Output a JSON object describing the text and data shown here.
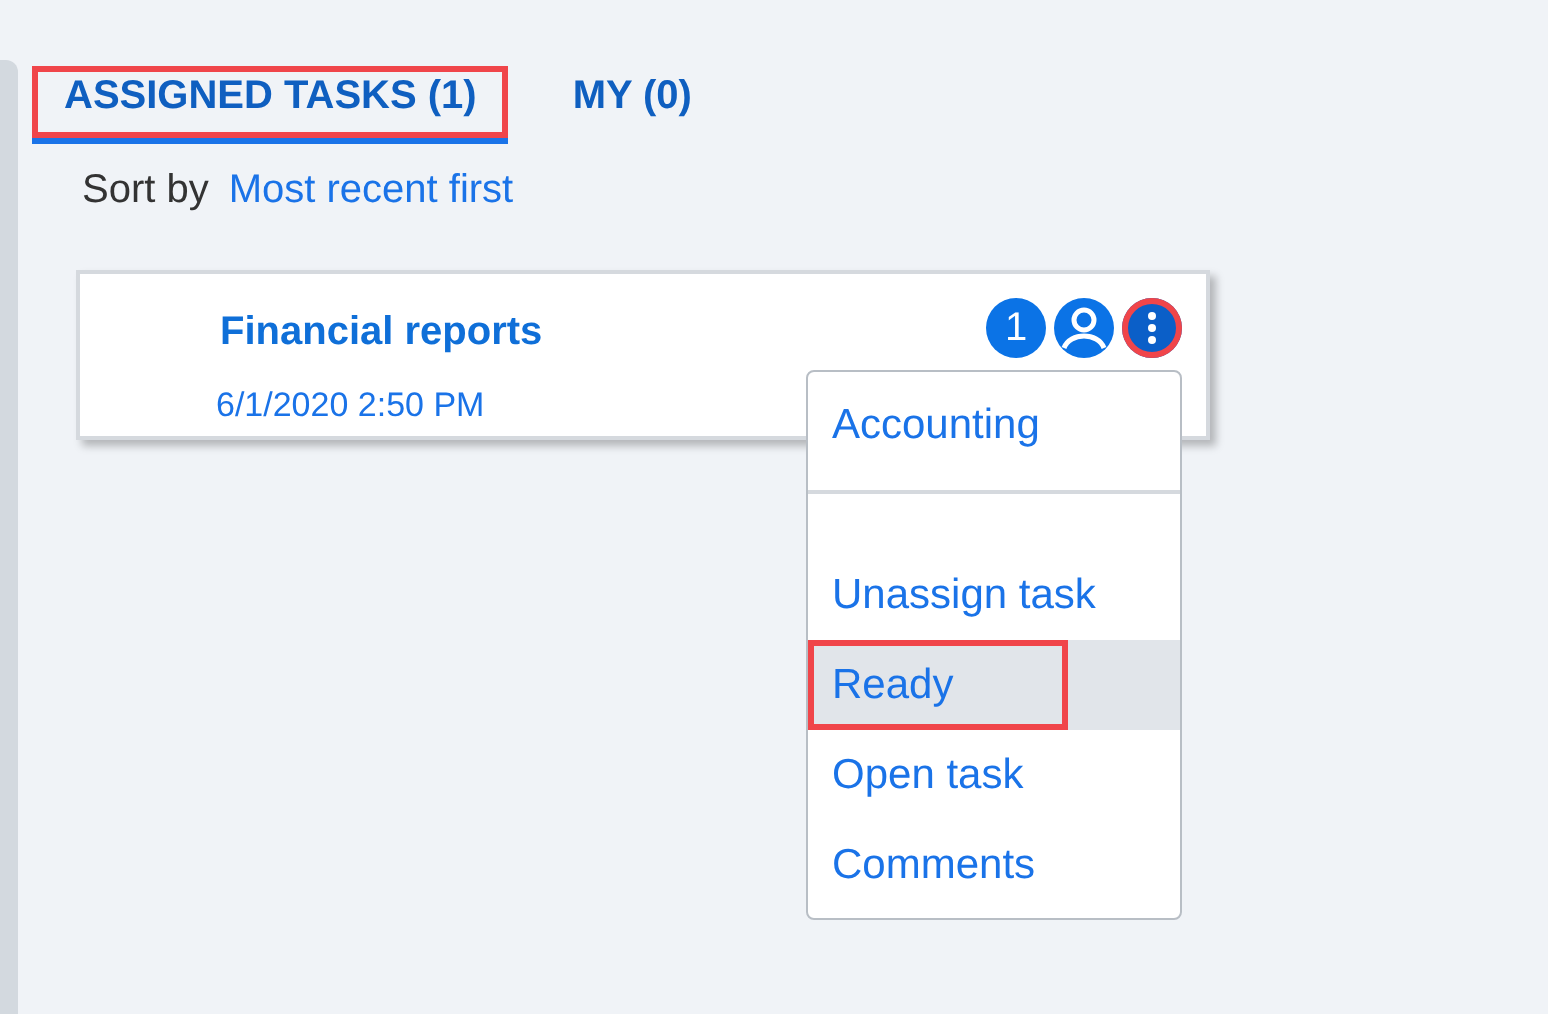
{
  "tabs": [
    {
      "label": "ASSIGNED TASKS (1)",
      "selected": true,
      "highlighted": true
    },
    {
      "label": "MY (0)",
      "selected": false,
      "highlighted": false
    }
  ],
  "sort": {
    "label": "Sort by",
    "value": "Most recent first"
  },
  "task": {
    "title": "Financial reports",
    "date": "6/1/2020 2:50 PM",
    "count": "1",
    "more_button": {
      "highlighted": true
    }
  },
  "menu": {
    "items": [
      {
        "kind": "header",
        "label": "Accounting",
        "selected": false,
        "highlighted": false
      },
      {
        "kind": "separator"
      },
      {
        "kind": "item",
        "label": "Unassign task",
        "selected": false,
        "highlighted": false
      },
      {
        "kind": "item",
        "label": "Ready",
        "selected": true,
        "highlighted": true
      },
      {
        "kind": "item",
        "label": "Open task",
        "selected": false,
        "highlighted": false
      },
      {
        "kind": "item",
        "label": "Comments",
        "selected": false,
        "highlighted": false
      }
    ]
  }
}
